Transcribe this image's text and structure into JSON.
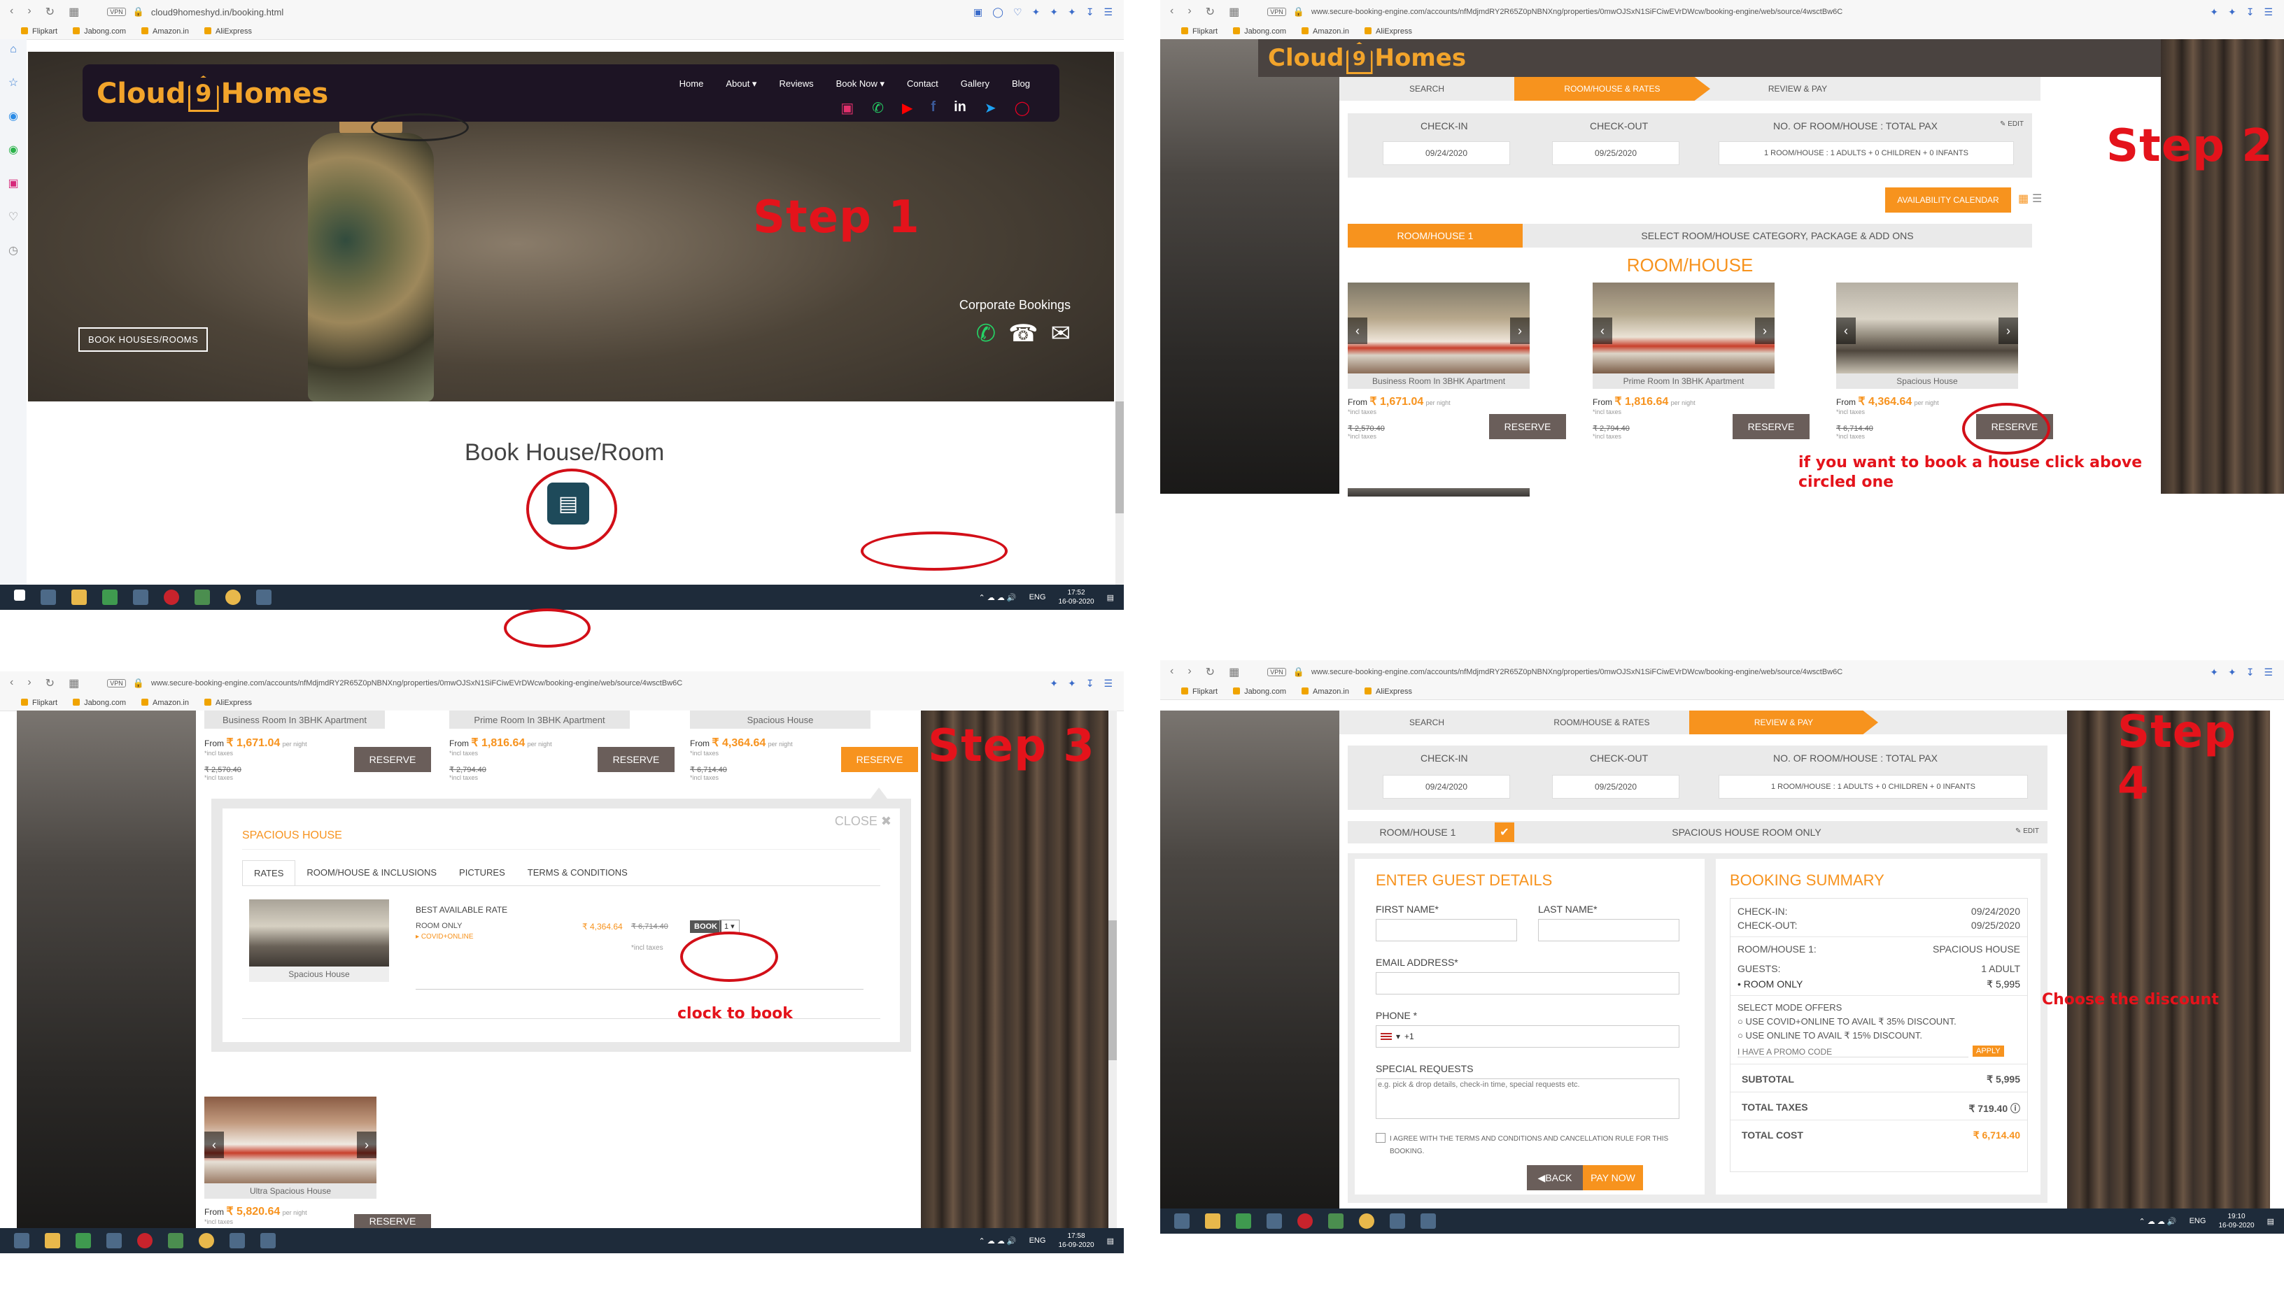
{
  "step1": {
    "url": "cloud9homeshyd.in/booking.html",
    "bookmarks": [
      "Flipkart",
      "Jabong.com",
      "Amazon.in",
      "AliExpress"
    ],
    "logo": {
      "part1": "Cloud",
      "nine": "9",
      "part2": "Homes"
    },
    "nav": [
      "Home",
      "About ▾",
      "Reviews",
      "Book Now ▾",
      "Contact",
      "Gallery",
      "Blog"
    ],
    "corporate_label": "Corporate Bookings",
    "book_button": "BOOK HOUSES/ROOMS",
    "step_label": "Step 1",
    "section_title": "Book House/Room",
    "taskbar": {
      "lang": "ENG",
      "time": "17:52",
      "date": "16-09-2020"
    }
  },
  "step2": {
    "url": "www.secure-booking-engine.com/accounts/nfMdjmdRY2R65Z0pNBNXng/properties/0mwOJSxN1SiFCiwEVrDWcw/booking-engine/web/source/4wsctBw6C",
    "tabs": [
      "SEARCH",
      "ROOM/HOUSE & RATES",
      "REVIEW & PAY"
    ],
    "fields": {
      "checkin_label": "CHECK-IN",
      "checkout_label": "CHECK-OUT",
      "pax_label": "NO. OF ROOM/HOUSE : TOTAL PAX",
      "checkin": "09/24/2020",
      "checkout": "09/25/2020",
      "pax": "1 ROOM/HOUSE : 1 ADULTS + 0 CHILDREN + 0 INFANTS",
      "edit": "EDIT"
    },
    "availability_btn": "AVAILABILITY CALENDAR",
    "room_tab": "ROOM/HOUSE 1",
    "room_tab_instructions": "SELECT ROOM/HOUSE CATEGORY, PACKAGE & ADD ONS",
    "section_title": "ROOM/HOUSE",
    "rooms": [
      {
        "name": "Business Room In 3BHK Apartment",
        "from": "From",
        "price": "₹ 1,671.04",
        "per": "per night",
        "incl": "*incl taxes",
        "strike": "₹ 2,570.40",
        "incl2": "*incl taxes",
        "btn": "RESERVE"
      },
      {
        "name": "Prime Room In 3BHK Apartment",
        "from": "From",
        "price": "₹ 1,816.64",
        "per": "per night",
        "incl": "*incl taxes",
        "strike": "₹ 2,794.40",
        "incl2": "*incl taxes",
        "btn": "RESERVE"
      },
      {
        "name": "Spacious House",
        "from": "From",
        "price": "₹ 4,364.64",
        "per": "per night",
        "incl": "*incl taxes",
        "strike": "₹ 6,714.40",
        "incl2": "*incl taxes",
        "btn": "RESERVE"
      }
    ],
    "step_label": "Step 2",
    "annotation": "if you want to book a house click above circled one"
  },
  "step3": {
    "step_label": "Step 3",
    "close": "CLOSE",
    "house_title": "SPACIOUS HOUSE",
    "tabs": [
      "RATES",
      "ROOM/HOUSE & INCLUSIONS",
      "PICTURES",
      "TERMS & CONDITIONS"
    ],
    "rate_title": "BEST AVAILABLE RATE",
    "room_only": "ROOM ONLY",
    "offer": "COVID+ONLINE",
    "price": "₹ 4,364.64",
    "strike": "₹ 6,714.40",
    "incl": "*incl taxes",
    "book_btn": "BOOK",
    "qty": "1",
    "img_caption": "Spacious House",
    "annotation": "clock to book",
    "extra_room": {
      "name": "Ultra Spacious House",
      "from": "From",
      "price": "₹ 5,820.64",
      "per": "per night",
      "incl": "*incl taxes",
      "btn": "RESERVE"
    },
    "taskbar": {
      "lang": "ENG",
      "time": "17:58",
      "date": "16-09-2020"
    }
  },
  "step4": {
    "step_label": "Step 4",
    "tabs": [
      "SEARCH",
      "ROOM/HOUSE & RATES",
      "REVIEW & PAY"
    ],
    "room_bar": {
      "label": "ROOM/HOUSE 1",
      "desc": "SPACIOUS HOUSE ROOM ONLY",
      "edit": "EDIT"
    },
    "guest": {
      "title": "ENTER GUEST DETAILS",
      "first": "FIRST NAME*",
      "last": "LAST NAME*",
      "email": "EMAIL ADDRESS*",
      "phone": "PHONE *",
      "phone_code": "+1",
      "special": "SPECIAL REQUESTS",
      "special_placeholder": "e.g. pick & drop details, check-in time, special requests etc.",
      "agree": "I AGREE WITH THE TERMS AND CONDITIONS AND CANCELLATION RULE FOR THIS BOOKING.",
      "back": "BACK",
      "pay": "PAY NOW"
    },
    "summary": {
      "title": "BOOKING SUMMARY",
      "checkin_l": "CHECK-IN:",
      "checkin": "09/24/2020",
      "checkout_l": "CHECK-OUT:",
      "checkout": "09/25/2020",
      "room_l": "ROOM/HOUSE 1:",
      "room": "SPACIOUS HOUSE",
      "guests_l": "GUESTS:",
      "guests": "1 ADULT",
      "room_only": "• ROOM ONLY",
      "room_price": "₹ 5,995",
      "offers_l": "SELECT MODE OFFERS",
      "offer1": "USE COVID+ONLINE TO AVAIL ₹ 35% DISCOUNT.",
      "offer2": "USE ONLINE TO AVAIL ₹ 15% DISCOUNT.",
      "promo": "I HAVE A PROMO CODE",
      "apply": "APPLY",
      "subtotal_l": "SUBTOTAL",
      "subtotal": "₹ 5,995",
      "taxes_l": "TOTAL TAXES",
      "taxes": "₹ 719.40",
      "total_l": "TOTAL COST",
      "total": "₹ 6,714.40"
    },
    "annotation": "Choose the discount",
    "taskbar": {
      "lang": "ENG",
      "time": "19:10",
      "date": "16-09-2020"
    }
  }
}
